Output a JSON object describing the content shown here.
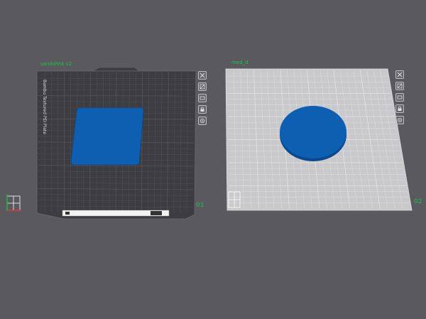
{
  "colors": {
    "background": "#5a5a5e",
    "plate_dark": "#3d3d41",
    "plate_light": "#c9c9cb",
    "grid_dark": "#56565a",
    "grid_light": "#e3e3e5",
    "object": "#0d5fb1",
    "object_edge": "#0a4a8c",
    "label_green": "#18c24a"
  },
  "plates": [
    {
      "label": "sandshnk v2",
      "number": "01",
      "brand_text": "Bambu Textured PEI Plate",
      "object_shape": "rounded-square",
      "tools": [
        "close-icon",
        "auto-arrange-icon",
        "orient-icon",
        "lock-icon",
        "settings-icon"
      ]
    },
    {
      "label": "med_d",
      "number": "02",
      "object_shape": "circle",
      "tools": [
        "close-icon",
        "auto-arrange-icon",
        "orient-icon",
        "lock-icon",
        "settings-icon"
      ]
    }
  ]
}
